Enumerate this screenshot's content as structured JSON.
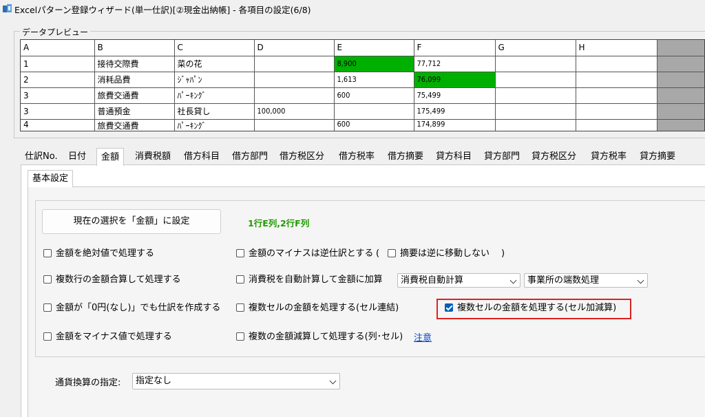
{
  "window": {
    "title": "Excelパターン登録ウィザード(単一仕訳)[②現金出納帳] - 各項目の設定(6/8)",
    "icon": "app-icon"
  },
  "preview": {
    "legend": "データプレビュー",
    "columns": [
      "A",
      "B",
      "C",
      "D",
      "E",
      "F",
      "G",
      "H"
    ],
    "rows": [
      [
        "1",
        "接待交際費",
        "菜の花",
        "",
        "8,900",
        "77,712",
        "",
        ""
      ],
      [
        "2",
        "消耗品費",
        "ｼﾞｬﾊﾟﾝ",
        "",
        "1,613",
        "76,099",
        "",
        ""
      ],
      [
        "3",
        "旅費交通費",
        "ﾊﾟｰｷﾝｸﾞ",
        "",
        "600",
        "75,499",
        "",
        ""
      ],
      [
        "3",
        "普通預金",
        "社長貸し",
        "100,000",
        "",
        "175,499",
        "",
        ""
      ],
      [
        "4",
        "旅費交通費",
        "ﾊﾟｰｷﾝｸﾞ",
        "",
        "600",
        "174,899",
        "",
        ""
      ]
    ],
    "highlight_color": "#00b000"
  },
  "tabs": [
    "仕訳No.",
    "日付",
    "金額",
    "消費税額",
    "借方科目",
    "借方部門",
    "借方税区分",
    "借方税率",
    "借方摘要",
    "貸方科目",
    "貸方部門",
    "貸方税区分",
    "貸方税率",
    "貸方摘要"
  ],
  "active_tab": "金額",
  "subtab": "基本設定",
  "settings": {
    "set_button": "現在の選択を「金額」に設定",
    "selection_info": "1行E列,2行F列",
    "cb_absolute": "金額を絶対値で処理する",
    "cb_sum_rows": "複数行の金額合算して処理する",
    "cb_zero": "金額が「0円(なし)」でも仕訳を作成する",
    "cb_negative": "金額をマイナス値で処理する",
    "cb_minus_reverse": "金額のマイナスは逆仕訳とする",
    "paren_open": "(",
    "cb_no_move": "摘要は逆に移動しない",
    "paren_close": ")",
    "cb_auto_tax": "消費税を自動計算して金額に加算",
    "combo_tax": "消費税自動計算",
    "combo_rounding": "事業所の端数処理",
    "cb_concat": "複数セルの金額を処理する(セル連結)",
    "cb_addsub": "複数セルの金額を処理する(セル加減算)",
    "cb_multi": "複数の金額減算して処理する(列･セル)",
    "note_link": "注意"
  },
  "currency": {
    "label": "通貨換算の指定:",
    "value": "指定なし"
  },
  "colors": {
    "accent": "#005fb8",
    "highlight_border": "#e02020",
    "info_green": "#1f9a00",
    "link": "#0044cc"
  }
}
